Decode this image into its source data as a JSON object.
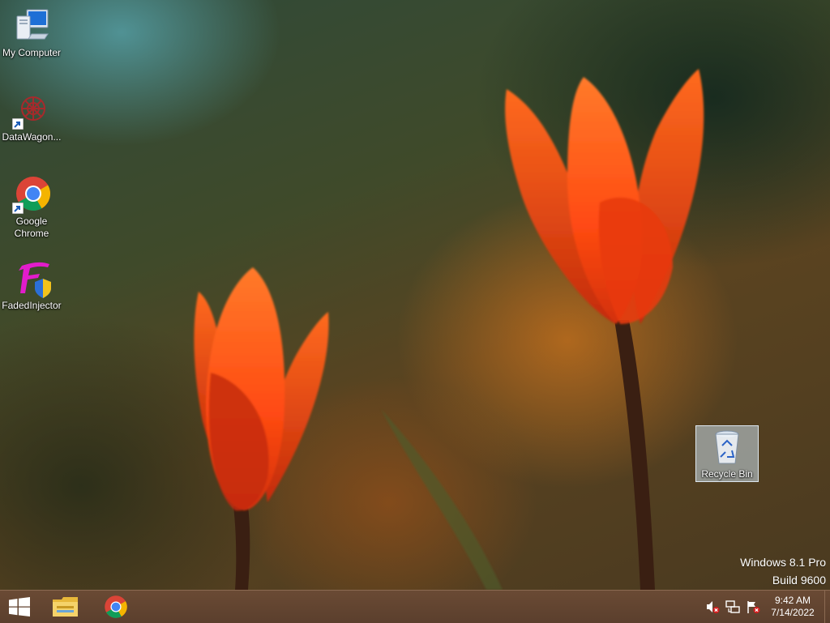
{
  "desktop": {
    "icons": [
      {
        "label": "My Computer",
        "icon": "computer-icon"
      },
      {
        "label": "DataWagon...",
        "icon": "datawagon-icon"
      },
      {
        "label": "Google Chrome",
        "icon": "chrome-icon"
      },
      {
        "label": "FadedInjector",
        "icon": "fadedinjector-icon"
      },
      {
        "label": "Recycle Bin",
        "icon": "recycle-bin-icon",
        "selected": true
      }
    ],
    "wallpaper": "red-tulips",
    "watermark": {
      "line1": "Windows 8.1 Pro",
      "line2": "Build 9600"
    }
  },
  "taskbar": {
    "start": "windows-logo-icon",
    "pinned": [
      {
        "name": "file-explorer",
        "icon": "folder-icon"
      },
      {
        "name": "google-chrome",
        "icon": "chrome-icon"
      }
    ],
    "tray": {
      "icons": [
        "speaker-muted-icon",
        "network-icon",
        "action-center-flag-icon"
      ],
      "time": "9:42 AM",
      "date": "7/14/2022"
    }
  },
  "colors": {
    "taskbar": "#5b3f2d",
    "tulip": "#ff4a10",
    "selection": "#c8dceb"
  }
}
